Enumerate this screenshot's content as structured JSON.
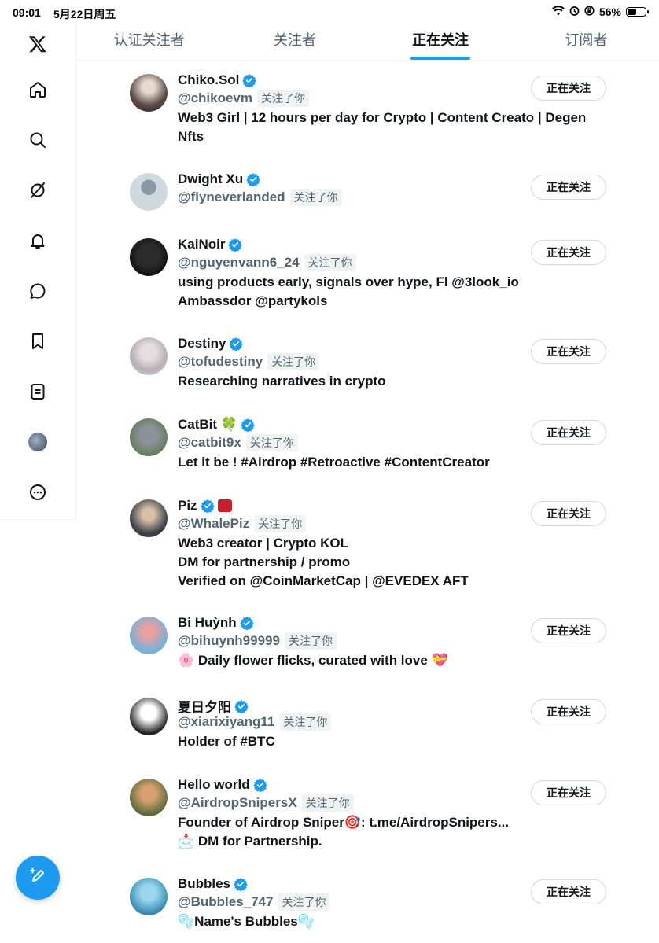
{
  "status_bar": {
    "time": "09:01",
    "date": "5月22日周五",
    "battery": "56%",
    "battery_level": 0.56
  },
  "sidebar": {
    "items": [
      {
        "icon": "x-logo-icon"
      },
      {
        "icon": "home-icon"
      },
      {
        "icon": "search-icon"
      },
      {
        "icon": "grok-icon"
      },
      {
        "icon": "bell-icon"
      },
      {
        "icon": "message-icon"
      },
      {
        "icon": "bookmark-icon"
      },
      {
        "icon": "lists-icon"
      },
      {
        "icon": "profile-avatar"
      },
      {
        "icon": "more-icon"
      }
    ],
    "compose_icon": "compose-icon"
  },
  "tabs": [
    {
      "label": "认证关注者",
      "active": false
    },
    {
      "label": "关注者",
      "active": false
    },
    {
      "label": "正在关注",
      "active": true
    },
    {
      "label": "订阅者",
      "active": false
    }
  ],
  "users": [
    {
      "name": "Chiko.Sol",
      "handle": "@chikoevm",
      "follows_you": "关注了你",
      "bio": "Web3 Girl | 12 hours per day for Crypto | Content Creato | Degen\nNfts",
      "button": "正在关注"
    },
    {
      "name": "Dwight Xu",
      "handle": "@flyneverlanded",
      "follows_you": "关注了你",
      "bio": "",
      "button": "正在关注"
    },
    {
      "name": "KaiNoir",
      "handle": "@nguyenvann6_24",
      "follows_you": "关注了你",
      "bio": "using products early, signals over hype, Fl @3look_io\nAmbassdor @partykols",
      "button": "正在关注"
    },
    {
      "name": "Destiny",
      "handle": "@tofudestiny",
      "follows_you": "关注了你",
      "bio": "Researching narratives in crypto",
      "button": "正在关注"
    },
    {
      "name": "CatBit 🍀",
      "handle": "@catbit9x",
      "follows_you": "关注了你",
      "bio": "Let it be ! #Airdrop #Retroactive #ContentCreator",
      "button": "正在关注"
    },
    {
      "name": "Piz",
      "handle": "@WhalePiz",
      "follows_you": "关注了你",
      "bio": "Web3 creator | Crypto KOL\nDM for partnership / promo\nVerified on @CoinMarketCap | @EVEDEX AFT",
      "button": "正在关注"
    },
    {
      "name": "Bi Huỳnh",
      "handle": "@bihuynh99999",
      "follows_you": "关注了你",
      "bio": "🌸 Daily flower flicks, curated with love 💝",
      "button": "正在关注"
    },
    {
      "name": "夏日夕阳",
      "handle": "@xiarixiyang11",
      "follows_you": "关注了你",
      "bio": "Holder of #BTC",
      "button": "正在关注"
    },
    {
      "name": "Hello world",
      "handle": "@AirdropSnipersX",
      "follows_you": "关注了你",
      "bio": "Founder of Airdrop Sniper🎯: t.me/AirdropSnipers...\n📩 DM for Partnership.",
      "button": "正在关注"
    },
    {
      "name": "Bubbles",
      "handle": "@Bubbles_747",
      "follows_you": "关注了你",
      "bio": "🫧Name's Bubbles🫧",
      "button": "正在关注"
    }
  ]
}
